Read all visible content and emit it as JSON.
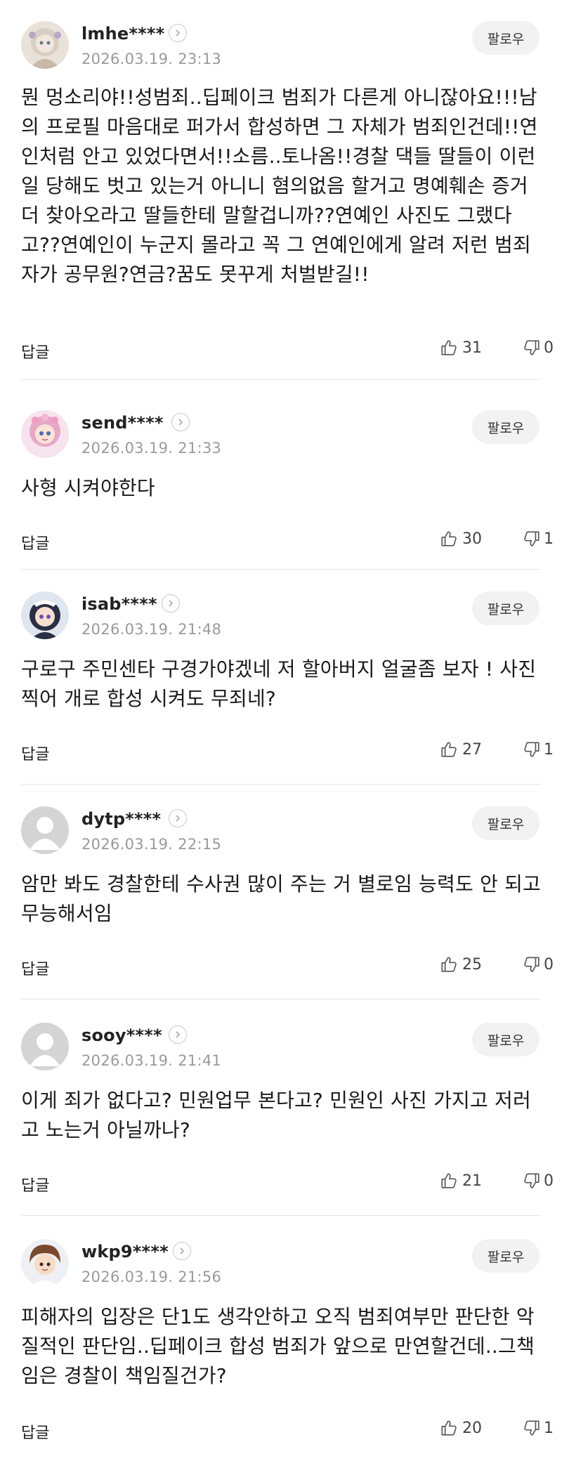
{
  "comments": [
    {
      "username": "lmhe****",
      "date": "2026.03.19. 23:13",
      "follow_label": "팔로우",
      "text": "뭔 멍소리야!!성범죄..딥페이크 범죄가 다른게 아니잖아요!!!남의 프로필 마음대로 퍼가서 합성하면 그 자체가 범죄인건데!!연인처럼 안고 있었다면서!!소름..토나옴!!경찰 댁들 딸들이 이런일 당해도 벗고 있는거 아니니 혐의없음 할거고 명예훼손 증거 더 찾아오라고 딸들한테 말할겁니까??연예인 사진도 그랬다고??연예인이 누군지 몰라고 꼭 그 연예인에게 알려 저런 범죄자가 공무원?연금?꿈도 못꾸게 처벌받길!!",
      "reply_label": "답글",
      "likes": "31",
      "dislikes": "0",
      "avatar_icon": "doll-avatar-icon"
    },
    {
      "username": "send****",
      "date": "2026.03.19. 21:33",
      "follow_label": "팔로우",
      "text": "사형 시켜야한다",
      "reply_label": "답글",
      "likes": "30",
      "dislikes": "1",
      "avatar_icon": "pink-girl-avatar-icon"
    },
    {
      "username": "isab****",
      "date": "2026.03.19. 21:48",
      "follow_label": "팔로우",
      "text": "구로구 주민센타 구경가야겠네 저 할아버지 얼굴좀 보자 ! 사진찍어 개로 합성 시켜도 무죄네?",
      "reply_label": "답글",
      "likes": "27",
      "dislikes": "1",
      "avatar_icon": "maid-girl-avatar-icon"
    },
    {
      "username": "dytp****",
      "date": "2026.03.19. 22:15",
      "follow_label": "팔로우",
      "text": "암만 봐도 경찰한테 수사권 많이 주는 거 별로임 능력도 안 되고 무능해서임",
      "reply_label": "답글",
      "likes": "25",
      "dislikes": "0",
      "avatar_icon": "default-user-avatar-icon"
    },
    {
      "username": "sooy****",
      "date": "2026.03.19. 21:41",
      "follow_label": "팔로우",
      "text": "이게 죄가 없다고? 민원업무 본다고? 민원인 사진 가지고 저러고 노는거 아닐까나?",
      "reply_label": "답글",
      "likes": "21",
      "dislikes": "0",
      "avatar_icon": "default-user-avatar-icon"
    },
    {
      "username": "wkp9****",
      "date": "2026.03.19. 21:56",
      "follow_label": "팔로우",
      "text": "피해자의 입장은 단1도 생각안하고 오직 범죄여부만 판단한 악질적인 판단임..딥페이크 합성 범죄가 앞으로 만연할건데..그책임은 경찰이 책임질건가?",
      "reply_label": "답글",
      "likes": "20",
      "dislikes": "1",
      "avatar_icon": "boy-avatar-icon"
    }
  ],
  "colors": {
    "divider": "#e6e6e6",
    "date": "#9a9a9a",
    "follow_bg": "#f2f2f2"
  }
}
